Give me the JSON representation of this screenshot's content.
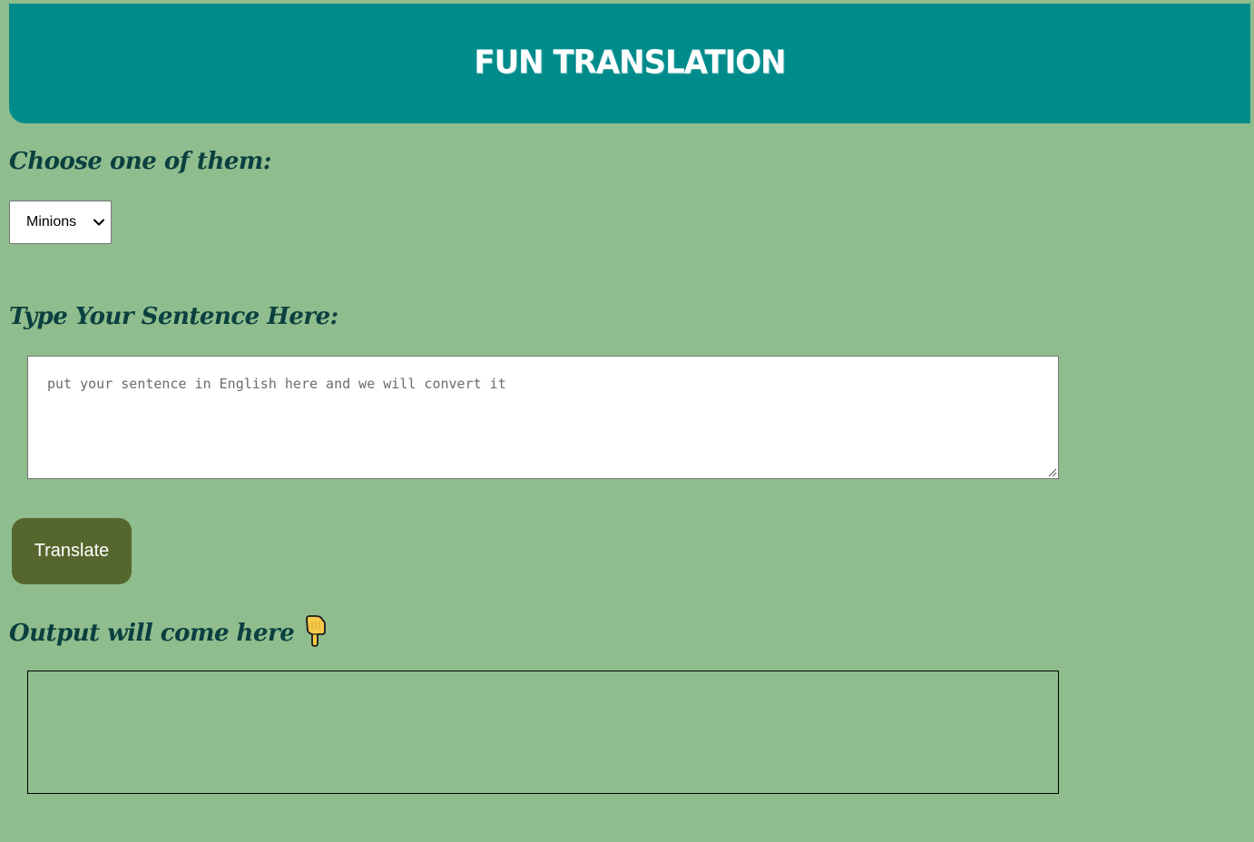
{
  "header": {
    "title": "FUN TRANSLATION"
  },
  "form": {
    "choose_label": "Choose one of them:",
    "select_value": "Minions",
    "sentence_label": "Type Your Sentence Here:",
    "input_placeholder": "put your sentence in English here and we will convert it",
    "input_value": "",
    "translate_label": "Translate",
    "output_label": "Output will come here",
    "output_icon": "pointing-down-hand-icon",
    "output_value": ""
  },
  "colors": {
    "background": "#8fbd8d",
    "header": "#008b8b",
    "button": "#55672e",
    "label_text": "#0b4040"
  }
}
